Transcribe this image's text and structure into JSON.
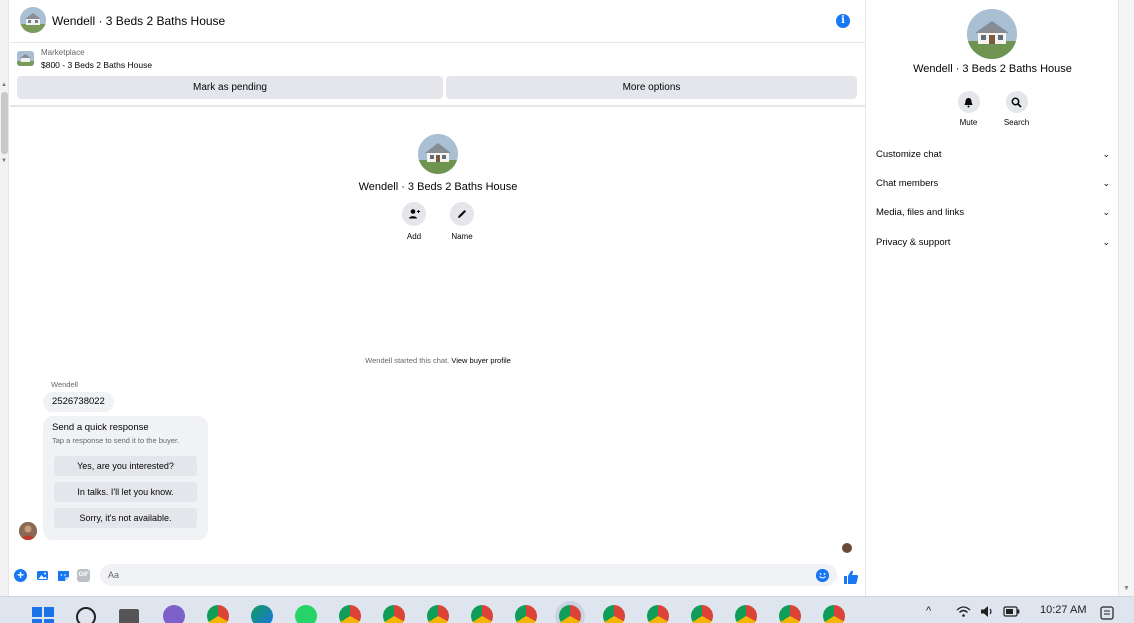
{
  "header": {
    "title": "Wendell · 3 Beds 2 Baths House"
  },
  "listing": {
    "label": "Marketplace",
    "price_title": "$800 - 3 Beds 2 Baths House",
    "mark_pending_label": "Mark as pending",
    "more_options_label": "More options"
  },
  "profile": {
    "name": "Wendell · 3 Beds 2 Baths House",
    "add_label": "Add",
    "name_label": "Name"
  },
  "thread": {
    "started_text": "Wendell started this chat.",
    "buyer_profile_link": "View buyer profile",
    "sender": "Wendell",
    "message": "2526738022",
    "quick_title": "Send a quick response",
    "quick_subtitle": "Tap a response to send it to the buyer.",
    "quick_responses": [
      "Yes, are you interested?",
      "In talks. I'll let you know.",
      "Sorry, it's not available."
    ]
  },
  "composer": {
    "placeholder": "Aa"
  },
  "right_panel": {
    "name": "Wendell · 3 Beds 2 Baths House",
    "mute_label": "Mute",
    "search_label": "Search",
    "menu": [
      "Customize chat",
      "Chat members",
      "Media, files and links",
      "Privacy & support"
    ]
  },
  "taskbar": {
    "time": "10:27 AM"
  },
  "colors": {
    "accent": "#1877f2",
    "button_grey": "#e4e6eb",
    "bubble": "#f0f2f5"
  }
}
